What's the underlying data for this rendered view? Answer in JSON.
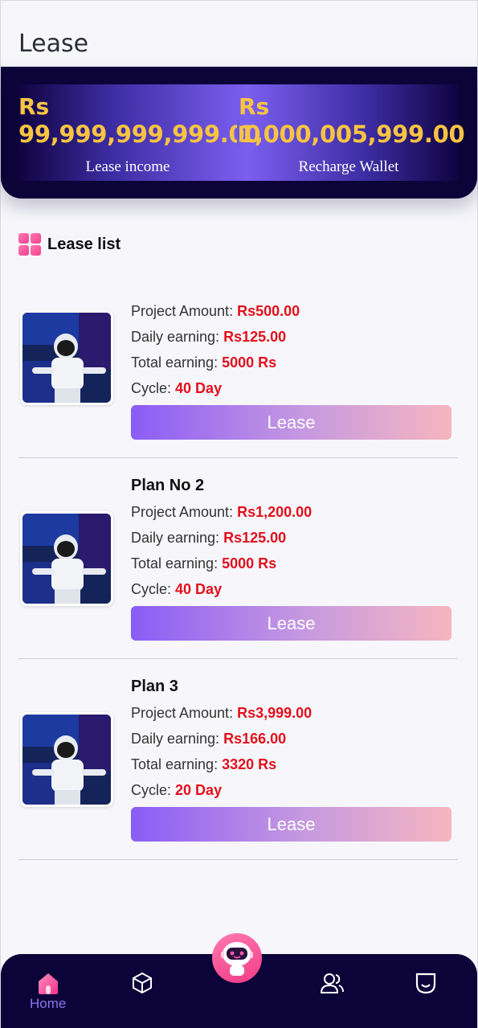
{
  "header": {
    "title": "Lease"
  },
  "wallet": {
    "lease_income": {
      "currency": "Rs",
      "amount": "99,999,999,999.00",
      "label": "Lease income"
    },
    "recharge_wallet": {
      "currency": "Rs",
      "amount": "1,000,005,999.00",
      "label": "Recharge Wallet"
    }
  },
  "lease_list": {
    "title": "Lease list",
    "labels": {
      "project_amount": "Project Amount:",
      "daily_earning": "Daily earning:",
      "total_earning": "Total earning:",
      "cycle": "Cycle:"
    },
    "plans": [
      {
        "name": "",
        "project_amount": "Rs500.00",
        "daily_earning": "Rs125.00",
        "total_earning": "5000 Rs",
        "cycle": "40 Day",
        "button": "Lease"
      },
      {
        "name": "Plan No 2",
        "project_amount": "Rs1,200.00",
        "daily_earning": "Rs125.00",
        "total_earning": "5000 Rs",
        "cycle": "40 Day",
        "button": "Lease"
      },
      {
        "name": "Plan 3",
        "project_amount": "Rs3,999.00",
        "daily_earning": "Rs166.00",
        "total_earning": "3320 Rs",
        "cycle": "20 Day",
        "button": "Lease"
      }
    ]
  },
  "nav": {
    "items": [
      {
        "icon": "home-icon",
        "label": "Home",
        "active": true
      },
      {
        "icon": "cube-icon",
        "label": ""
      },
      {
        "icon": "robot-icon",
        "label": ""
      },
      {
        "icon": "users-icon",
        "label": ""
      },
      {
        "icon": "smile-icon",
        "label": ""
      }
    ]
  },
  "colors": {
    "accent": "#8b5cf6",
    "value_red": "#e3101c",
    "gold": "#f7c443",
    "navy": "#0c0338"
  }
}
